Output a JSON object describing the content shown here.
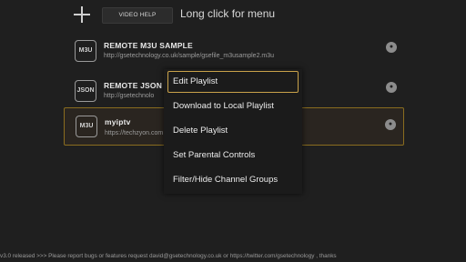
{
  "toolbar": {
    "video_help_label": "VIDEO HELP",
    "hint": "Long click for menu"
  },
  "playlists": [
    {
      "badge": "M3U",
      "title": "REMOTE M3U SAMPLE",
      "url": "http://gsetechnology.co.uk/sample/gsefile_m3usample2.m3u"
    },
    {
      "badge": "JSON",
      "title": "REMOTE JSON SA",
      "url": "http://gsetechnolo"
    },
    {
      "badge": "M3U",
      "title": "myiptv",
      "url": "https://techzyon.com"
    }
  ],
  "context_menu": {
    "items": [
      "Edit Playlist",
      "Download to Local Playlist",
      "Delete Playlist",
      "Set Parental Controls",
      "Filter/Hide Channel Groups"
    ],
    "selected": "Edit Playlist"
  },
  "footer": {
    "ticker": "v3.0 released >>>  Please report bugs or features request david@gsetechnology.co.uk or https://twitter.com/gsetechnology , thanks"
  },
  "colors": {
    "background": "#1f1f1f",
    "accent": "#c9a24a"
  }
}
